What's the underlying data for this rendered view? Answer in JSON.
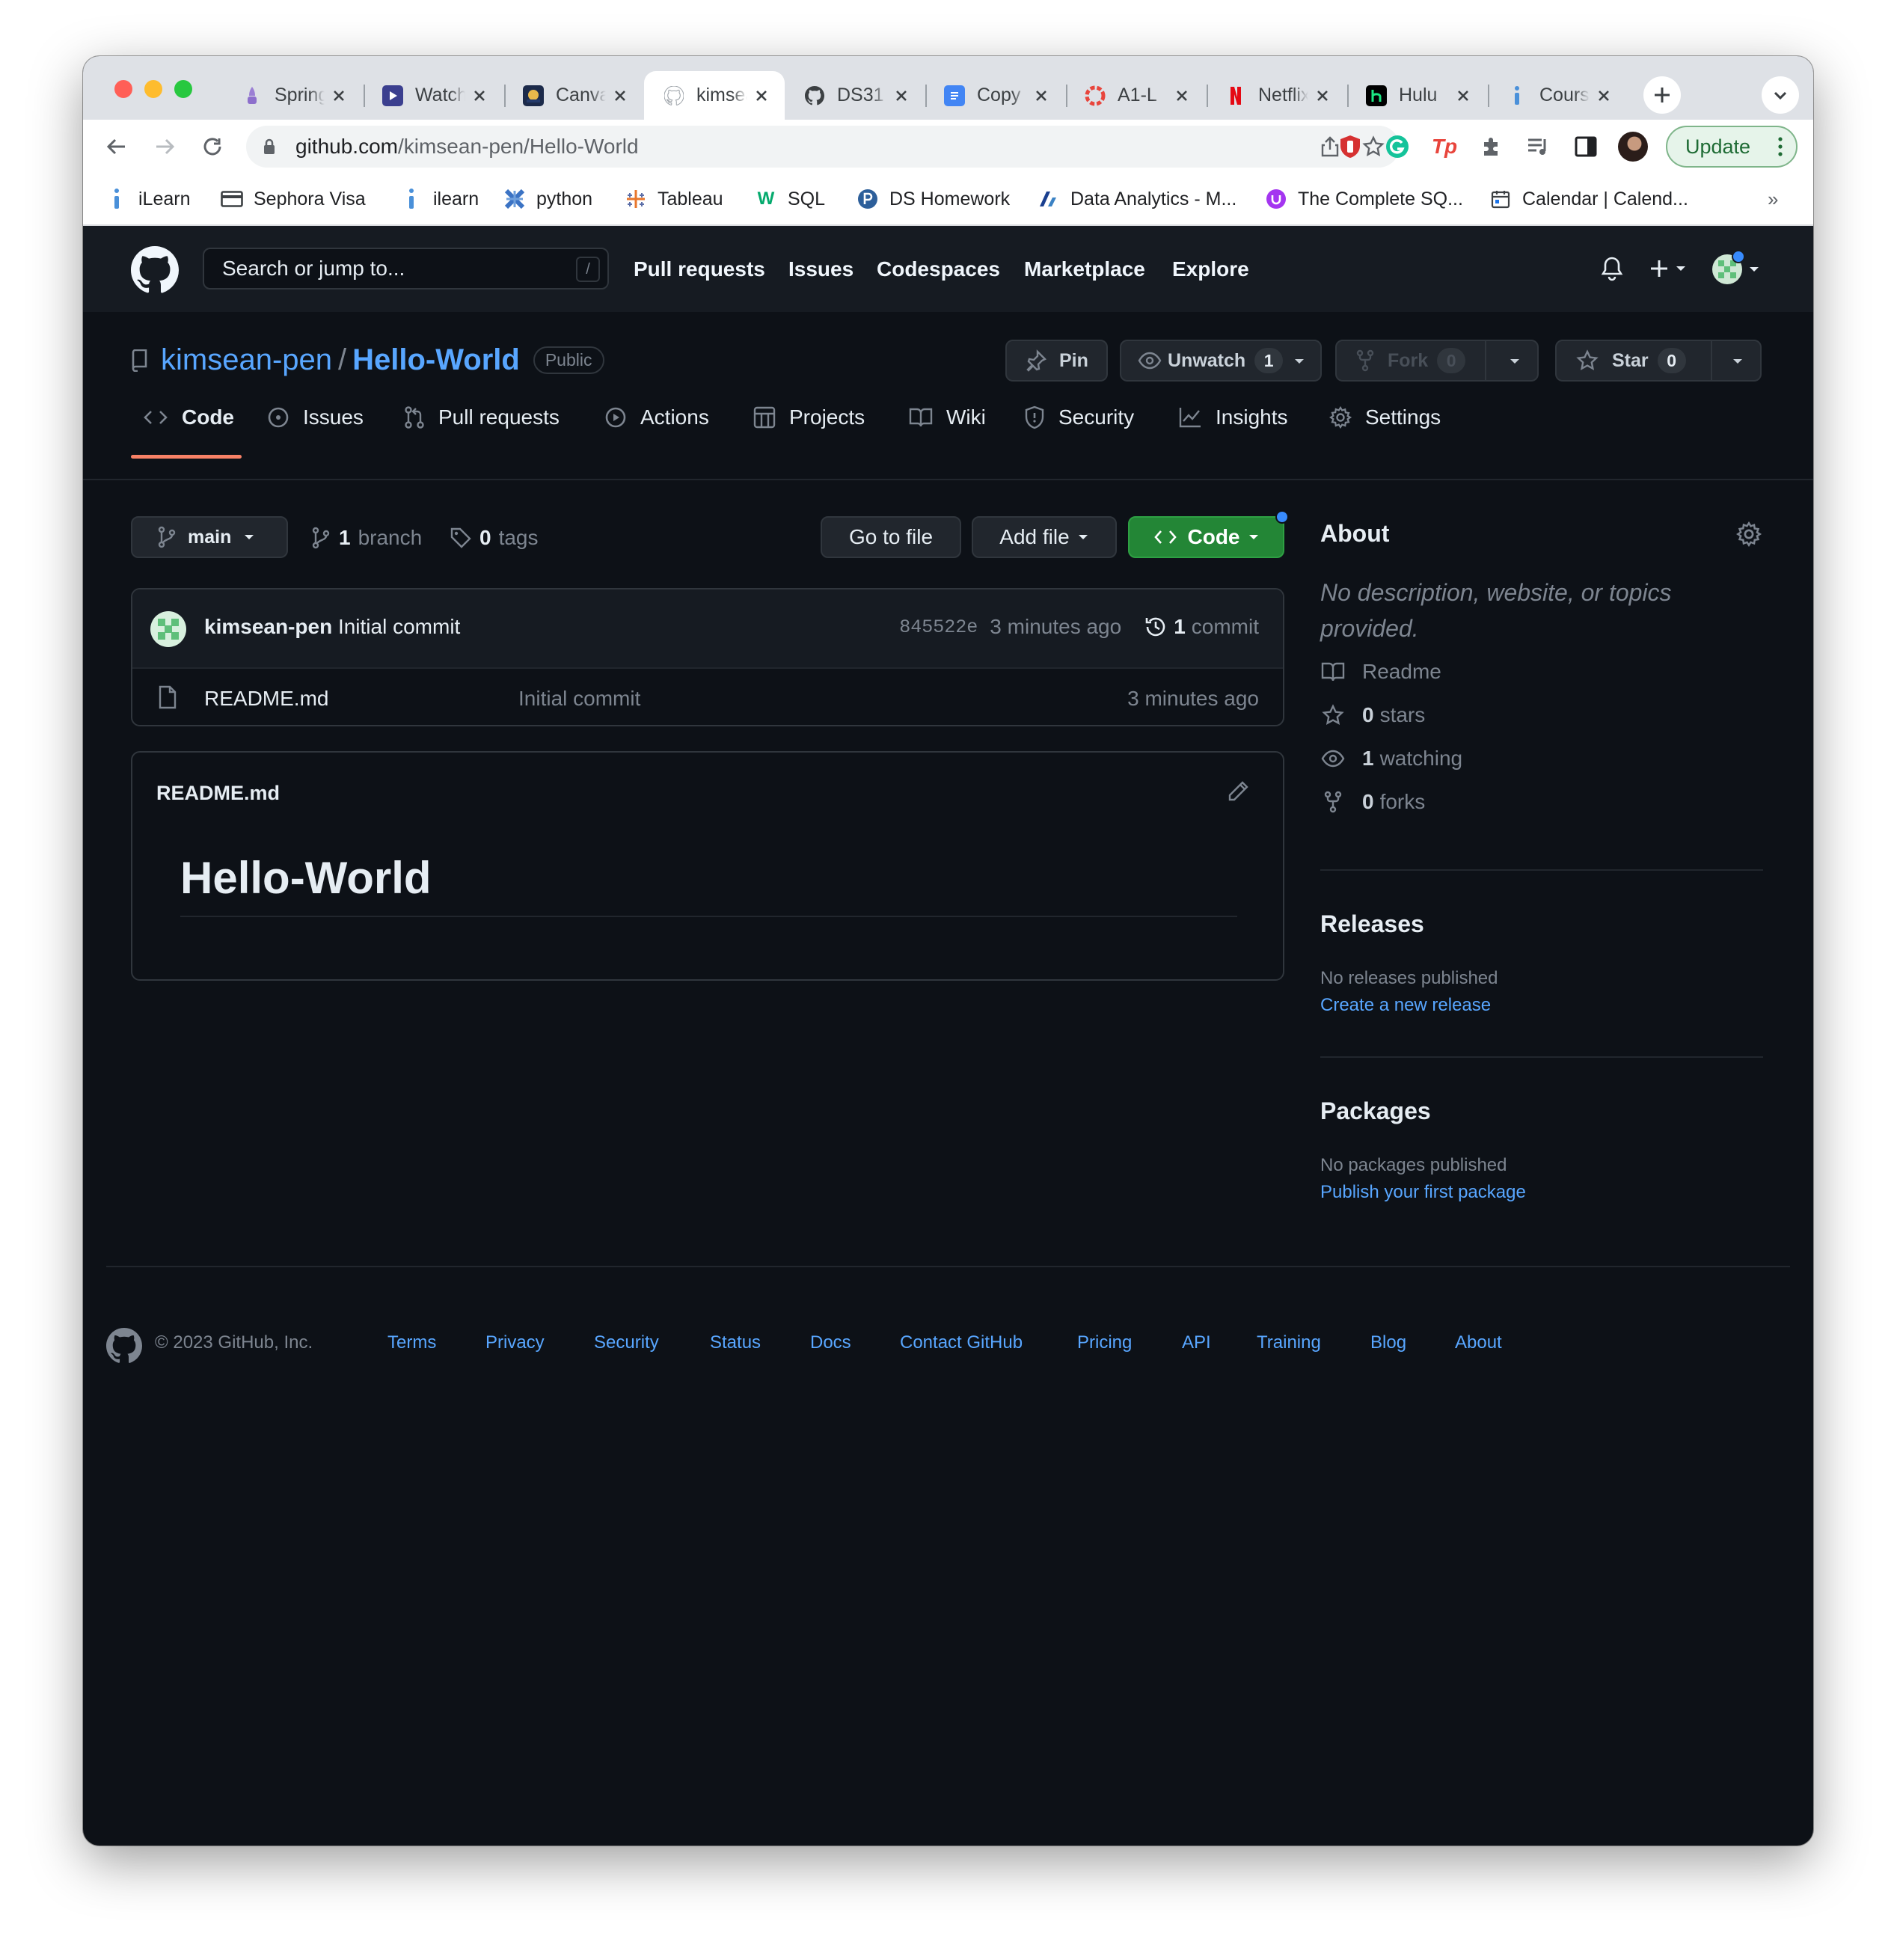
{
  "browser": {
    "tabs": [
      {
        "label": "Spring",
        "icon": "lavender-tab-icon"
      },
      {
        "label": "Watch",
        "icon": "play-tab-icon"
      },
      {
        "label": "Canvas",
        "icon": "canvas-tab-icon"
      },
      {
        "label": "kimsean-pen",
        "icon": "github-tab-icon",
        "active": true
      },
      {
        "label": "DS31",
        "icon": "github-tab-icon"
      },
      {
        "label": "Copy",
        "icon": "docs-tab-icon"
      },
      {
        "label": "A1-L",
        "icon": "lifesaver-tab-icon"
      },
      {
        "label": "Netflix",
        "icon": "netflix-tab-icon"
      },
      {
        "label": "Hulu",
        "icon": "hulu-tab-icon"
      },
      {
        "label": "Course",
        "icon": "info-tab-icon"
      }
    ],
    "url_host": "github.com",
    "url_path": "/kimsean-pen/Hello-World",
    "update_label": "Update",
    "bookmarks": [
      "iLearn",
      "Sephora Visa",
      "ilearn",
      "python",
      "Tableau",
      "SQL",
      "DS Homework",
      "Data Analytics - M...",
      "The Complete SQ...",
      "Calendar | Calend..."
    ],
    "more_bookmarks": "»"
  },
  "header": {
    "search_placeholder": "Search or jump to...",
    "search_key": "/",
    "nav": [
      "Pull requests",
      "Issues",
      "Codespaces",
      "Marketplace",
      "Explore"
    ]
  },
  "repo": {
    "owner": "kimsean-pen",
    "separator": "/",
    "name": "Hello-World",
    "visibility": "Public",
    "pin_label": "Pin",
    "unwatch_label": "Unwatch",
    "watch_count": "1",
    "fork_label": "Fork",
    "fork_count": "0",
    "star_label": "Star",
    "star_count": "0",
    "tabs": [
      "Code",
      "Issues",
      "Pull requests",
      "Actions",
      "Projects",
      "Wiki",
      "Security",
      "Insights",
      "Settings"
    ]
  },
  "files": {
    "branch": "main",
    "branch_count": "1",
    "branch_label": "branch",
    "tag_count": "0",
    "tag_label": "tags",
    "go_to_file": "Go to file",
    "add_file": "Add file",
    "code_label": "Code",
    "commit_author": "kimsean-pen",
    "commit_message": "Initial commit",
    "commit_sha": "845522e",
    "commit_time": "3 minutes ago",
    "commit_count": "1",
    "commit_label": "commit",
    "rows": [
      {
        "name": "README.md",
        "message": "Initial commit",
        "time": "3 minutes ago"
      }
    ]
  },
  "readme": {
    "filename": "README.md",
    "heading": "Hello-World"
  },
  "sidebar": {
    "about_title": "About",
    "description": "No description, website, or topics provided.",
    "readme": "Readme",
    "stars_count": "0",
    "stars_label": "stars",
    "watching_count": "1",
    "watching_label": "watching",
    "forks_count": "0",
    "forks_label": "forks",
    "releases_title": "Releases",
    "releases_none": "No releases published",
    "releases_link": "Create a new release",
    "packages_title": "Packages",
    "packages_none": "No packages published",
    "packages_link": "Publish your first package"
  },
  "footer": {
    "copyright": "© 2023 GitHub, Inc.",
    "links": [
      "Terms",
      "Privacy",
      "Security",
      "Status",
      "Docs",
      "Contact GitHub",
      "Pricing",
      "API",
      "Training",
      "Blog",
      "About"
    ]
  },
  "colors": {
    "bg": "#0d1117",
    "header_bg": "#161b22",
    "accent_link": "#58a6ff",
    "code_button": "#238636",
    "border": "#30363d",
    "tab_underline": "#f78166"
  }
}
